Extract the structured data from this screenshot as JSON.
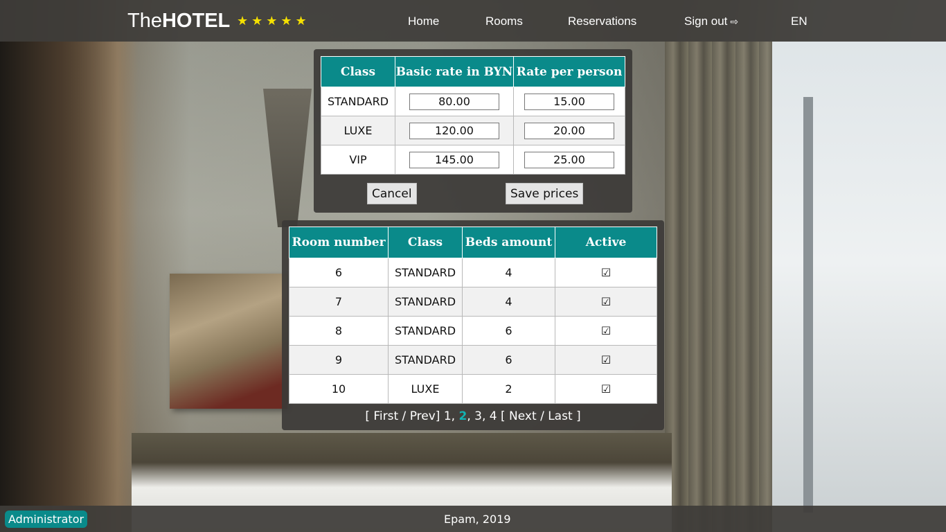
{
  "brand": {
    "prefix": "The",
    "bold": "HOTEL",
    "stars": "★★★★★",
    "star_color": "#f5e000"
  },
  "nav": {
    "home": "Home",
    "rooms": "Rooms",
    "reservations": "Reservations",
    "signout": "Sign out",
    "signout_icon": "⇨",
    "language": "EN"
  },
  "rates": {
    "headers": [
      "Class",
      "Basic rate in BYN",
      "Rate per person"
    ],
    "rows": [
      {
        "class": "STANDARD",
        "basic": "80.00",
        "person": "15.00"
      },
      {
        "class": "LUXE",
        "basic": "120.00",
        "person": "20.00"
      },
      {
        "class": "VIP",
        "basic": "145.00",
        "person": "25.00"
      }
    ],
    "cancel_label": "Cancel",
    "save_label": "Save prices"
  },
  "rooms": {
    "headers": [
      "Room number",
      "Class",
      "Beds amount",
      "Active"
    ],
    "rows": [
      {
        "number": "6",
        "class": "STANDARD",
        "beds": "4",
        "active": "☑"
      },
      {
        "number": "7",
        "class": "STANDARD",
        "beds": "4",
        "active": "☑"
      },
      {
        "number": "8",
        "class": "STANDARD",
        "beds": "6",
        "active": "☑"
      },
      {
        "number": "9",
        "class": "STANDARD",
        "beds": "6",
        "active": "☑"
      },
      {
        "number": "10",
        "class": "LUXE",
        "beds": "2",
        "active": "☑"
      }
    ]
  },
  "pager": {
    "open_bracket": "[",
    "first": "First",
    "slash1": "/",
    "prev": "Prev",
    "close_bracket1": "]",
    "pages": [
      "1",
      "2",
      "3",
      "4"
    ],
    "current": "2",
    "open_bracket2": "[",
    "next": "Next",
    "slash2": "/",
    "last": "Last",
    "close_bracket2": "]"
  },
  "footer": {
    "role": "Administrator",
    "copyright": "Epam, 2019"
  },
  "colors": {
    "accent": "#0a8a8a",
    "current_page": "#12b3b3"
  }
}
